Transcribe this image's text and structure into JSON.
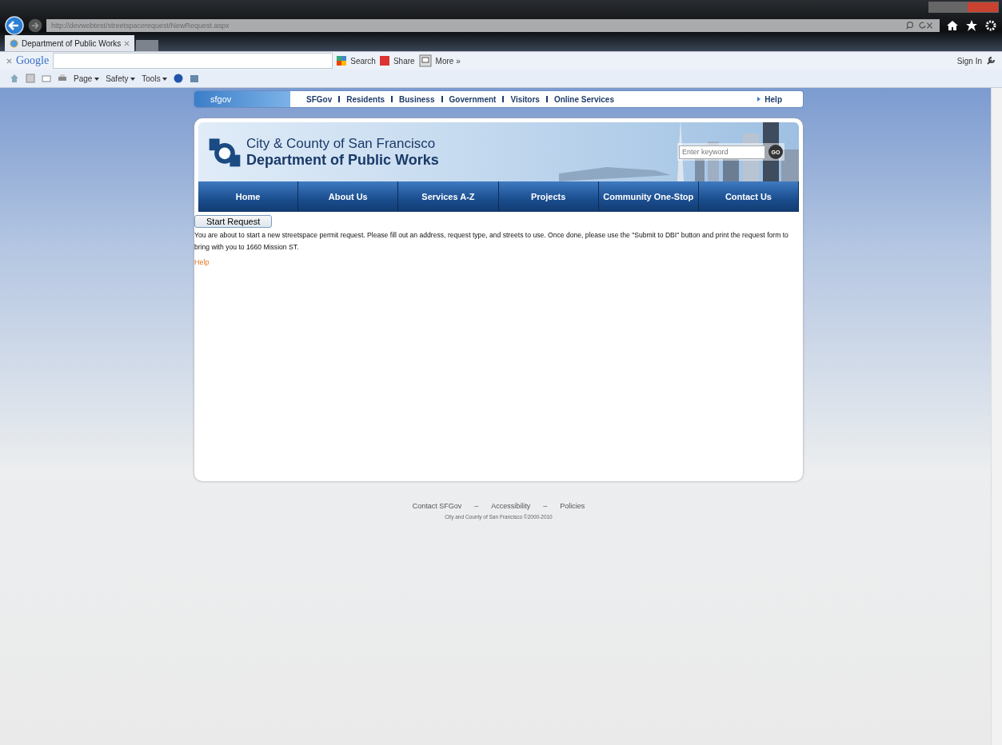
{
  "browser": {
    "address": "http://devwebtest/streetspacerequest/NewRequest.aspx",
    "tabs": [
      {
        "label": "Department of Public Works",
        "selected": true
      }
    ],
    "toolbar": {
      "brand": "Google",
      "search": "Search",
      "share": "Share",
      "more": "More »",
      "sign_in": "Sign In"
    },
    "command_bar": [
      "Page",
      "Safety",
      "Tools"
    ]
  },
  "site": {
    "top_logo": "sfgov",
    "top_links": [
      "SFGov",
      "Residents",
      "Business",
      "Government",
      "Visitors",
      "Online Services"
    ],
    "help": "Help",
    "header_line1": "City & County of San Francisco",
    "header_line2": "Department of Public Works",
    "search": {
      "placeholder": "Enter keyword"
    },
    "go": "GO",
    "nav": [
      {
        "label": "Home"
      },
      {
        "label": "About Us"
      },
      {
        "label": "Services A-Z"
      },
      {
        "label": "Projects"
      },
      {
        "label": "Community One-Stop"
      },
      {
        "label": "Contact Us"
      }
    ],
    "start_button": "Start Request",
    "intro": "You are about to start a new streetspace permit request. Please fill out an address, request type, and streets to use. Once done, please use the \"Submit to DBI\" button and print the request form to bring with you to 1660 Mission ST.",
    "help_link": "Help"
  },
  "footer": {
    "links": [
      "Contact SFGov",
      "Accessibility",
      "Policies"
    ],
    "separator": "–",
    "copyright": "City and County of San Francisco ©2000-2010"
  }
}
